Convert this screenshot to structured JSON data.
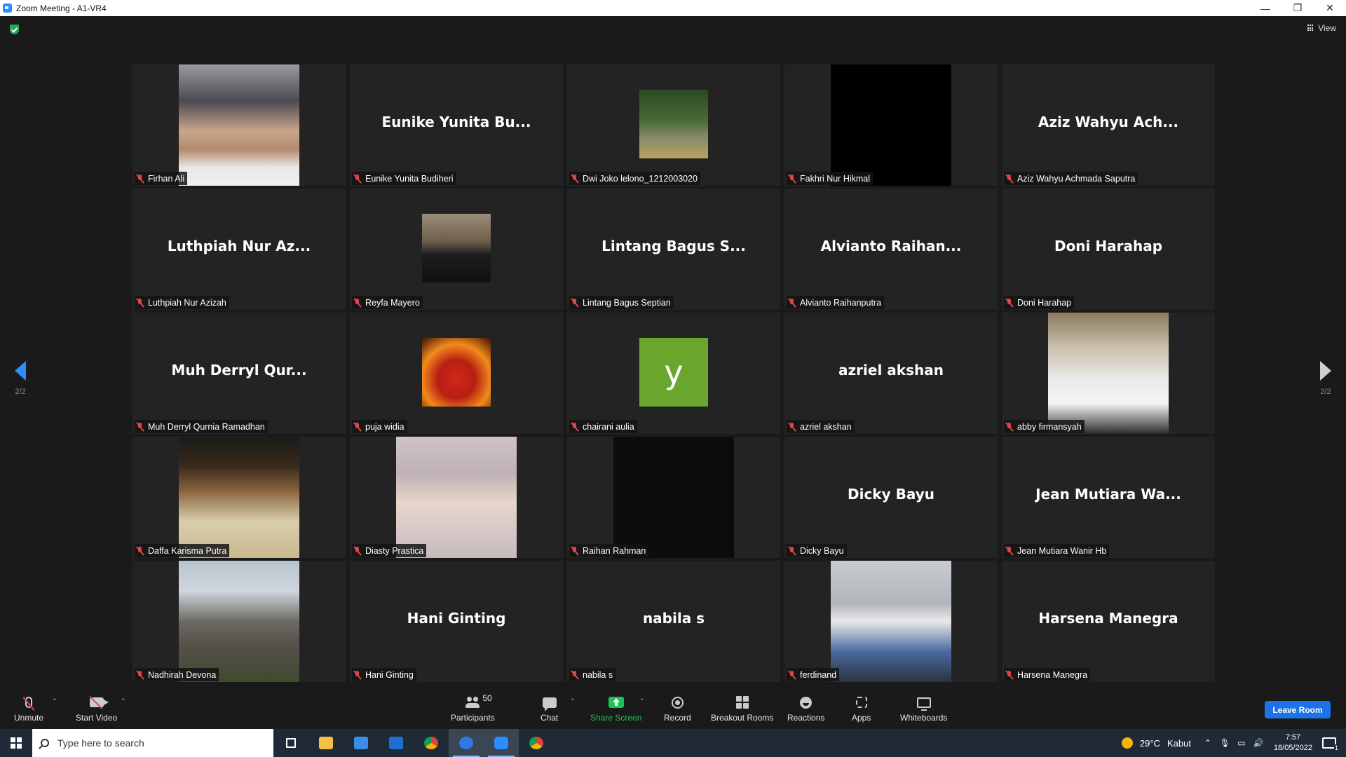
{
  "window": {
    "title": "Zoom Meeting - A1-VR4",
    "minimize": "—",
    "restore": "❐",
    "close": "✕"
  },
  "view": {
    "label": "View"
  },
  "paging": {
    "left": "2/2",
    "right": "2/2"
  },
  "participants": [
    {
      "name": "Firhan Ali",
      "display": "",
      "visual": "video-helmet"
    },
    {
      "name": "Eunike Yunita Budiheri",
      "display": "Eunike Yunita Bu...",
      "visual": "none"
    },
    {
      "name": "Dwi Joko lelono_1212003020",
      "display": "",
      "visual": "thumb-park"
    },
    {
      "name": "Fakhri Nur Hikmal",
      "display": "",
      "visual": "video-black"
    },
    {
      "name": "Aziz Wahyu Achmada Saputra",
      "display": "Aziz Wahyu Ach...",
      "visual": "none"
    },
    {
      "name": "Luthpiah Nur Azizah",
      "display": "Luthpiah Nur Az...",
      "visual": "none"
    },
    {
      "name": "Reyfa Mayero",
      "display": "",
      "visual": "thumb-man"
    },
    {
      "name": "Lintang Bagus Septian",
      "display": "Lintang Bagus S...",
      "visual": "none"
    },
    {
      "name": "Alvianto Raihanputra",
      "display": "Alvianto Raihan...",
      "visual": "none"
    },
    {
      "name": "Doni Harahap",
      "display": "Doni Harahap",
      "visual": "none"
    },
    {
      "name": "Muh Derryl Qurnia Ramadhan",
      "display": "Muh Derryl Qur...",
      "visual": "none"
    },
    {
      "name": "puja widia",
      "display": "",
      "visual": "thumb-fire"
    },
    {
      "name": "chairani aulia",
      "display": "y",
      "visual": "thumb-letter"
    },
    {
      "name": "azriel akshan",
      "display": "azriel akshan",
      "visual": "none"
    },
    {
      "name": "abby firmansyah",
      "display": "",
      "visual": "video-abby"
    },
    {
      "name": "Daffa Karisma Putra",
      "display": "",
      "visual": "video-daffa"
    },
    {
      "name": "Diasty Prastica",
      "display": "",
      "visual": "video-diasty"
    },
    {
      "name": "Raihan Rahman",
      "display": "",
      "visual": "video-dark"
    },
    {
      "name": "Dicky Bayu",
      "display": "Dicky Bayu",
      "visual": "none"
    },
    {
      "name": "Jean Mutiara Wanir Hb",
      "display": "Jean Mutiara Wa...",
      "visual": "none"
    },
    {
      "name": "Nadhirah Devona",
      "display": "",
      "visual": "video-temple"
    },
    {
      "name": "Hani Ginting",
      "display": "Hani Ginting",
      "visual": "none"
    },
    {
      "name": "nabila s",
      "display": "nabila s",
      "visual": "none"
    },
    {
      "name": "ferdinand",
      "display": "",
      "visual": "video-ferdinand"
    },
    {
      "name": "Harsena Manegra",
      "display": "Harsena Manegra",
      "visual": "none"
    }
  ],
  "toolbar": {
    "unmute": "Unmute",
    "start_video": "Start Video",
    "participants": "Participants",
    "participants_count": "50",
    "chat": "Chat",
    "share_screen": "Share Screen",
    "record": "Record",
    "breakout_rooms": "Breakout Rooms",
    "reactions": "Reactions",
    "apps": "Apps",
    "whiteboards": "Whiteboards",
    "leave": "Leave Room"
  },
  "taskbar": {
    "search_placeholder": "Type here to search",
    "weather_temp": "29°C",
    "weather_desc": "Kabut",
    "time": "7:57",
    "date": "18/05/2022",
    "notifications": "1"
  },
  "colors": {
    "accent": "#2d8cff",
    "share": "#1fbf5a",
    "leave": "#1c73e8",
    "muted": "#e0454b"
  }
}
